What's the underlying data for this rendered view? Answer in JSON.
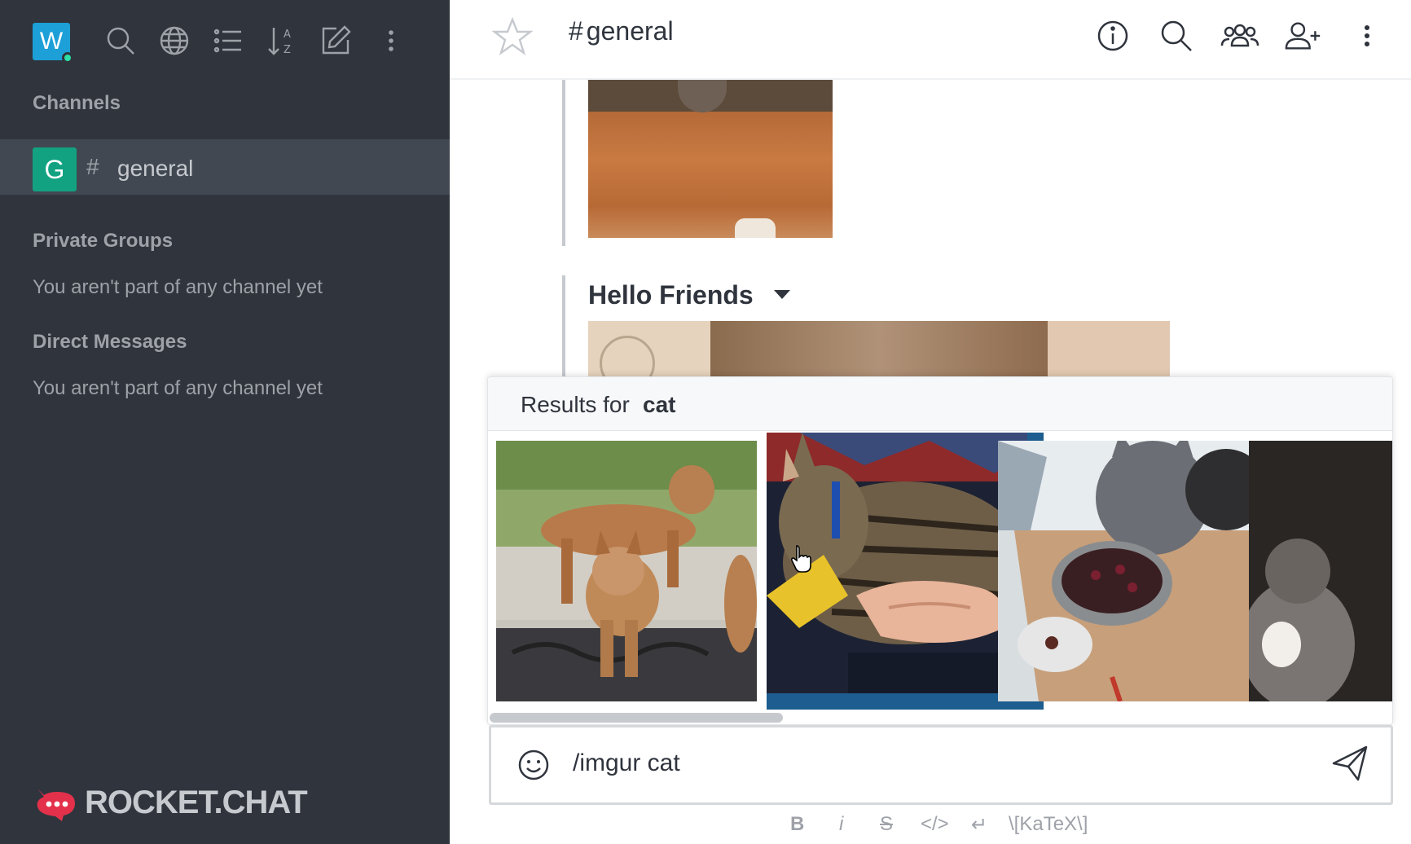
{
  "sidebar": {
    "workspace_initial": "W",
    "sections": {
      "channels": "Channels",
      "private_groups": "Private Groups",
      "direct_messages": "Direct Messages"
    },
    "channels": [
      {
        "initial": "G",
        "hash": "#",
        "name": "general"
      }
    ],
    "empty_private": "You aren't part of any channel yet",
    "empty_direct": "You aren't part of any channel yet",
    "brand": "ROCKET.CHAT"
  },
  "header": {
    "hash": "#",
    "channel": "general"
  },
  "messages": {
    "attachment_title": "Hello Friends"
  },
  "popup": {
    "results_prefix": "Results for",
    "query": "cat",
    "selected_index": 1,
    "results": [
      {
        "icon": "bobcat-image"
      },
      {
        "icon": "tabby-cat-image"
      },
      {
        "icon": "gray-cat-bowl-image"
      },
      {
        "icon": "cat-partial-image"
      }
    ]
  },
  "composer": {
    "value": "/imgur cat"
  },
  "format_bar": {
    "bold": "B",
    "italic": "i",
    "strike": "S",
    "code": "</>",
    "multiline": "↵",
    "katex": "\\[KaTeX\\]"
  },
  "colors": {
    "sidebar_bg": "#2f343d",
    "selected_frame": "#1d5d8f",
    "online": "#2de0a5",
    "general_avatar": "#12a281",
    "workspace_avatar": "#1d9fd8"
  }
}
